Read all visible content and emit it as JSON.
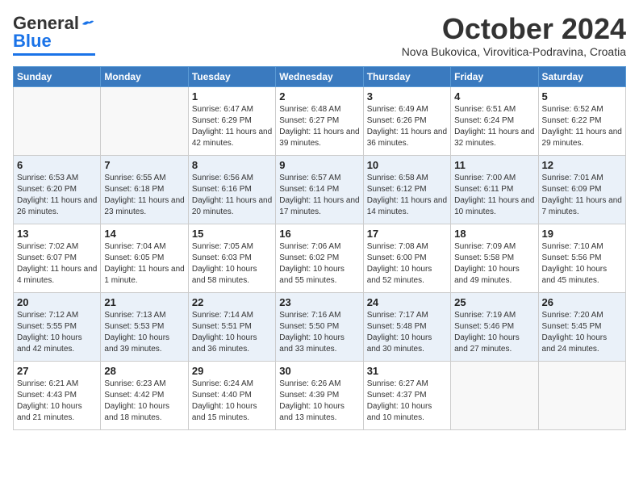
{
  "header": {
    "logo_line1": "General",
    "logo_line2": "Blue",
    "month": "October 2024",
    "location": "Nova Bukovica, Virovitica-Podravina, Croatia"
  },
  "weekdays": [
    "Sunday",
    "Monday",
    "Tuesday",
    "Wednesday",
    "Thursday",
    "Friday",
    "Saturday"
  ],
  "weeks": [
    [
      {
        "day": "",
        "info": ""
      },
      {
        "day": "",
        "info": ""
      },
      {
        "day": "1",
        "info": "Sunrise: 6:47 AM\nSunset: 6:29 PM\nDaylight: 11 hours and 42 minutes."
      },
      {
        "day": "2",
        "info": "Sunrise: 6:48 AM\nSunset: 6:27 PM\nDaylight: 11 hours and 39 minutes."
      },
      {
        "day": "3",
        "info": "Sunrise: 6:49 AM\nSunset: 6:26 PM\nDaylight: 11 hours and 36 minutes."
      },
      {
        "day": "4",
        "info": "Sunrise: 6:51 AM\nSunset: 6:24 PM\nDaylight: 11 hours and 32 minutes."
      },
      {
        "day": "5",
        "info": "Sunrise: 6:52 AM\nSunset: 6:22 PM\nDaylight: 11 hours and 29 minutes."
      }
    ],
    [
      {
        "day": "6",
        "info": "Sunrise: 6:53 AM\nSunset: 6:20 PM\nDaylight: 11 hours and 26 minutes."
      },
      {
        "day": "7",
        "info": "Sunrise: 6:55 AM\nSunset: 6:18 PM\nDaylight: 11 hours and 23 minutes."
      },
      {
        "day": "8",
        "info": "Sunrise: 6:56 AM\nSunset: 6:16 PM\nDaylight: 11 hours and 20 minutes."
      },
      {
        "day": "9",
        "info": "Sunrise: 6:57 AM\nSunset: 6:14 PM\nDaylight: 11 hours and 17 minutes."
      },
      {
        "day": "10",
        "info": "Sunrise: 6:58 AM\nSunset: 6:12 PM\nDaylight: 11 hours and 14 minutes."
      },
      {
        "day": "11",
        "info": "Sunrise: 7:00 AM\nSunset: 6:11 PM\nDaylight: 11 hours and 10 minutes."
      },
      {
        "day": "12",
        "info": "Sunrise: 7:01 AM\nSunset: 6:09 PM\nDaylight: 11 hours and 7 minutes."
      }
    ],
    [
      {
        "day": "13",
        "info": "Sunrise: 7:02 AM\nSunset: 6:07 PM\nDaylight: 11 hours and 4 minutes."
      },
      {
        "day": "14",
        "info": "Sunrise: 7:04 AM\nSunset: 6:05 PM\nDaylight: 11 hours and 1 minute."
      },
      {
        "day": "15",
        "info": "Sunrise: 7:05 AM\nSunset: 6:03 PM\nDaylight: 10 hours and 58 minutes."
      },
      {
        "day": "16",
        "info": "Sunrise: 7:06 AM\nSunset: 6:02 PM\nDaylight: 10 hours and 55 minutes."
      },
      {
        "day": "17",
        "info": "Sunrise: 7:08 AM\nSunset: 6:00 PM\nDaylight: 10 hours and 52 minutes."
      },
      {
        "day": "18",
        "info": "Sunrise: 7:09 AM\nSunset: 5:58 PM\nDaylight: 10 hours and 49 minutes."
      },
      {
        "day": "19",
        "info": "Sunrise: 7:10 AM\nSunset: 5:56 PM\nDaylight: 10 hours and 45 minutes."
      }
    ],
    [
      {
        "day": "20",
        "info": "Sunrise: 7:12 AM\nSunset: 5:55 PM\nDaylight: 10 hours and 42 minutes."
      },
      {
        "day": "21",
        "info": "Sunrise: 7:13 AM\nSunset: 5:53 PM\nDaylight: 10 hours and 39 minutes."
      },
      {
        "day": "22",
        "info": "Sunrise: 7:14 AM\nSunset: 5:51 PM\nDaylight: 10 hours and 36 minutes."
      },
      {
        "day": "23",
        "info": "Sunrise: 7:16 AM\nSunset: 5:50 PM\nDaylight: 10 hours and 33 minutes."
      },
      {
        "day": "24",
        "info": "Sunrise: 7:17 AM\nSunset: 5:48 PM\nDaylight: 10 hours and 30 minutes."
      },
      {
        "day": "25",
        "info": "Sunrise: 7:19 AM\nSunset: 5:46 PM\nDaylight: 10 hours and 27 minutes."
      },
      {
        "day": "26",
        "info": "Sunrise: 7:20 AM\nSunset: 5:45 PM\nDaylight: 10 hours and 24 minutes."
      }
    ],
    [
      {
        "day": "27",
        "info": "Sunrise: 6:21 AM\nSunset: 4:43 PM\nDaylight: 10 hours and 21 minutes."
      },
      {
        "day": "28",
        "info": "Sunrise: 6:23 AM\nSunset: 4:42 PM\nDaylight: 10 hours and 18 minutes."
      },
      {
        "day": "29",
        "info": "Sunrise: 6:24 AM\nSunset: 4:40 PM\nDaylight: 10 hours and 15 minutes."
      },
      {
        "day": "30",
        "info": "Sunrise: 6:26 AM\nSunset: 4:39 PM\nDaylight: 10 hours and 13 minutes."
      },
      {
        "day": "31",
        "info": "Sunrise: 6:27 AM\nSunset: 4:37 PM\nDaylight: 10 hours and 10 minutes."
      },
      {
        "day": "",
        "info": ""
      },
      {
        "day": "",
        "info": ""
      }
    ]
  ]
}
